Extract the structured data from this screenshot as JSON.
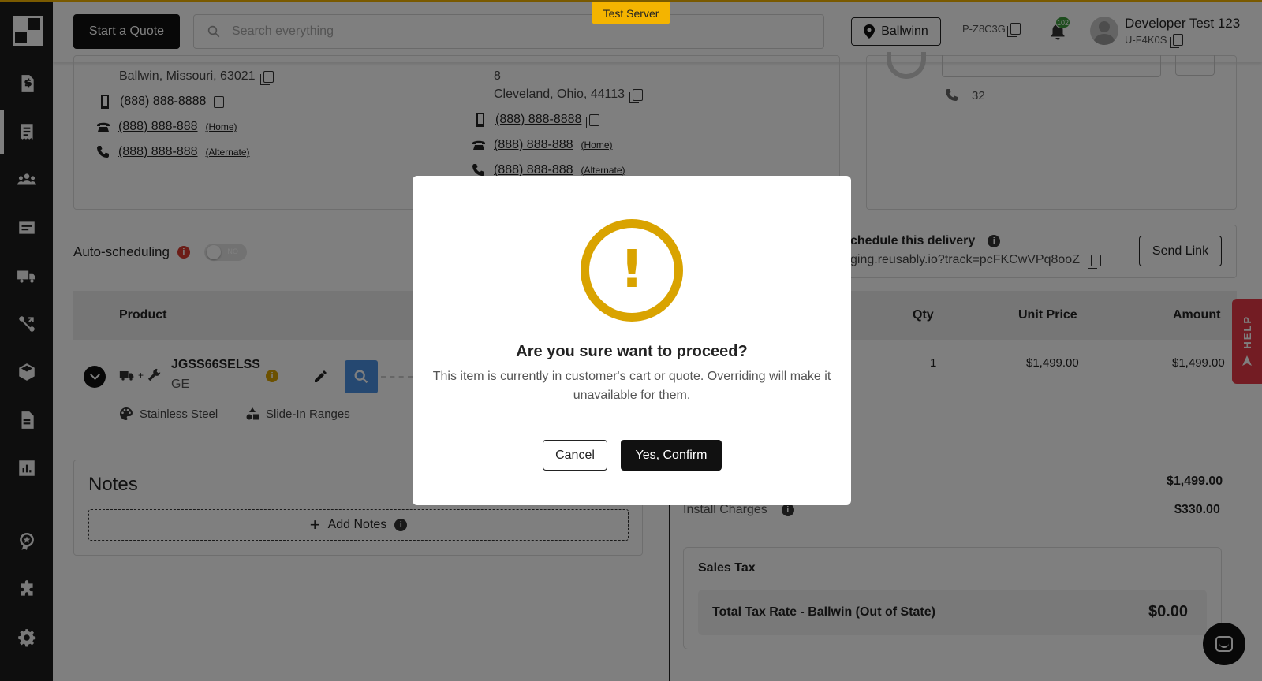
{
  "app": {
    "test_server_label": "Test Server"
  },
  "topbar": {
    "start_quote": "Start a Quote",
    "search_placeholder": "Search everything",
    "location": "Ballwinn",
    "store_code": "P-Z8C3G",
    "notification_count": "102",
    "user_name": "Developer Test 123",
    "user_code": "U-F4K0S"
  },
  "customer": {
    "billing": {
      "city_line": "Ballwin, Missouri, 63021",
      "mobile": "(888) 888-8888",
      "home": "(888) 888-888",
      "home_tag": "(Home)",
      "alternate": "(888) 888-888",
      "alternate_tag": "(Alternate)"
    },
    "shipping": {
      "line2": "8",
      "city_line": "Cleveland, Ohio, 44113",
      "mobile": "(888) 888-8888",
      "home": "(888) 888-888",
      "home_tag": "(Home)",
      "alternate": "(888) 888-888",
      "alternate_tag": "(Alternate)"
    },
    "contact": {
      "phone": "32"
    }
  },
  "scheduling": {
    "auto_label": "Auto-scheduling",
    "toggle_state": "NO",
    "delivery_title": "chedule this delivery",
    "delivery_link": "ging.reusably.io?track=pcFKCwVPq8ooZ",
    "send_link": "Send Link"
  },
  "help_tab": "HELP",
  "table": {
    "headers": {
      "product": "Product",
      "qty": "Qty",
      "unit_price": "Unit Price",
      "amount": "Amount"
    },
    "rows": [
      {
        "sku": "JGSS66SELSS",
        "brand": "GE",
        "color": "Stainless Steel",
        "category": "Slide-In Ranges",
        "qty": "1",
        "unit_price": "$1,499.00",
        "amount": "$1,499.00"
      }
    ]
  },
  "notes": {
    "title": "Notes",
    "add_label": "Add Notes"
  },
  "totals": {
    "subtotal": "$1,499.00",
    "install_label": "Install Charges",
    "install_value": "$330.00",
    "sales_tax_title": "Sales Tax",
    "tax_rate_label": "Total Tax Rate - Ballwin (Out of State)",
    "tax_rate_value": "$0.00"
  },
  "modal": {
    "title": "Are you sure want to proceed?",
    "message": "This item is currently in customer's cart or quote. Overriding will make it unavailable for them.",
    "cancel": "Cancel",
    "confirm": "Yes, Confirm",
    "icon": "warning-icon",
    "icon_color": "#d9a300"
  },
  "colors": {
    "accent": "#f4b400",
    "sidebar": "#1d1d1d",
    "help": "#e63946",
    "scan": "#4a90e2"
  }
}
